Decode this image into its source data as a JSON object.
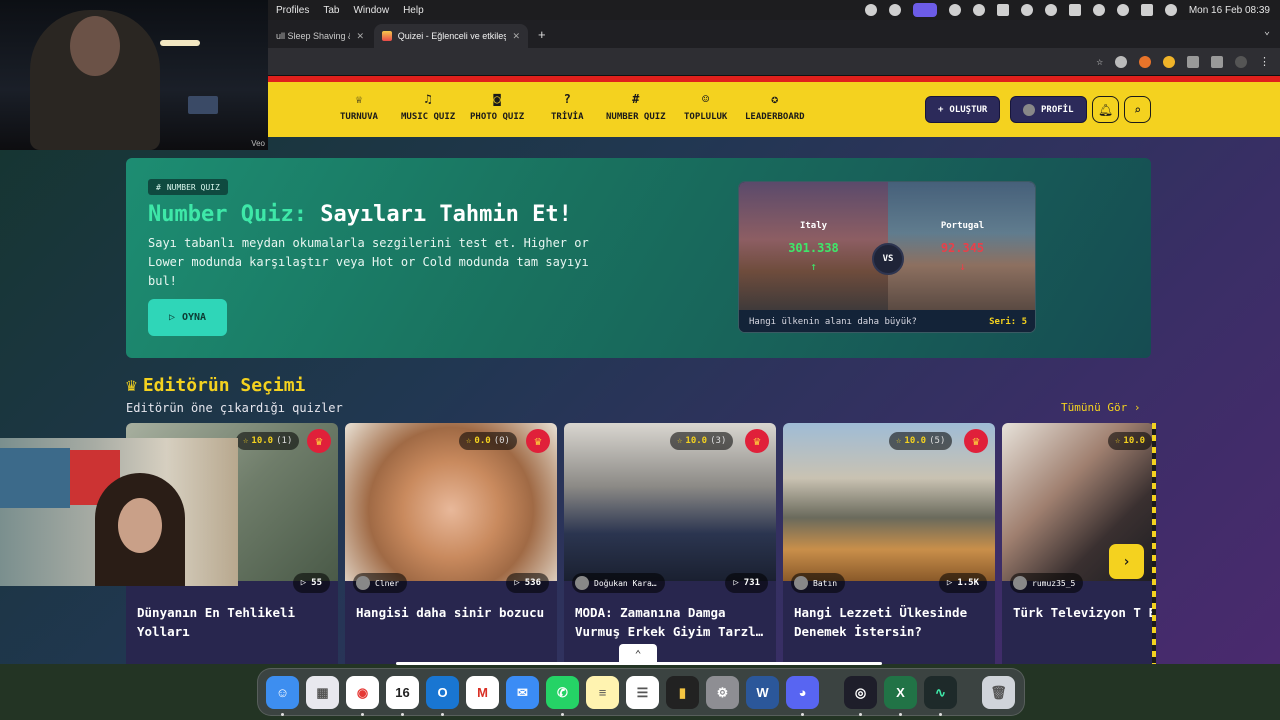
{
  "menubar": {
    "menus": [
      "Profiles",
      "Tab",
      "Window",
      "Help"
    ],
    "clock": "Mon 16 Feb  08:39"
  },
  "browser": {
    "tabs": [
      {
        "title": "ull Sleep Shaving & H"
      },
      {
        "title": "Quizei - Eğlenceli ve etkileşim"
      }
    ]
  },
  "nav": {
    "items": [
      "TURNUVA",
      "MUSIC QUIZ",
      "PHOTO QUIZ",
      "TRİVİA",
      "NUMBER QUIZ",
      "TOPLULUK",
      "LEADERBOARD"
    ],
    "create": "OLUŞTUR",
    "profile": "PROFİL"
  },
  "hero": {
    "badge": "NUMBER QUIZ",
    "title_highlight": "Number Quiz:",
    "title_rest": " Sayıları Tahmin Et!",
    "description": "Sayı tabanlı meydan okumalarla sezgilerini test et. Higher or Lower modunda karşılaştır veya Hot or Cold modunda tam sayıyı bul!",
    "play": "OYNA",
    "versus": {
      "left_country": "Italy",
      "left_value": "301.338",
      "right_country": "Portugal",
      "right_value": "92.345",
      "vs": "VS",
      "question": "Hangi ülkenin alanı daha büyük?",
      "streak": "Seri: 5",
      "up_color": "#3ee86a",
      "down_color": "#e8404a"
    }
  },
  "editors_pick": {
    "title": "Editörün Seçimi",
    "subtitle": "Editörün öne çıkardığı quizler",
    "see_all": "Tümünü Gör",
    "cards": [
      {
        "rating": "10.0",
        "count": "(1)",
        "author": "",
        "plays": "55",
        "title": "Dünyanın En Tehlikeli Yolları"
      },
      {
        "rating": "0.0",
        "count": "(0)",
        "author": "Clner",
        "plays": "536",
        "title": "Hangisi daha sinir bozucu"
      },
      {
        "rating": "10.0",
        "count": "(3)",
        "author": "Doğukan Kara…",
        "plays": "731",
        "title": "MODA: Zamanına Damga Vurmuş Erkek Giyim Tarzl…"
      },
      {
        "rating": "10.0",
        "count": "(5)",
        "author": "Batın",
        "plays": "1.5K",
        "title": "Hangi Lezzeti Ülkesinde Denemek İstersin?"
      },
      {
        "rating": "10.0",
        "count": "",
        "author": "rumuz35_5",
        "plays": "",
        "title": "Türk Televizyon T En İyi Racon"
      }
    ]
  },
  "webcam": {
    "watermark": "Veo"
  }
}
